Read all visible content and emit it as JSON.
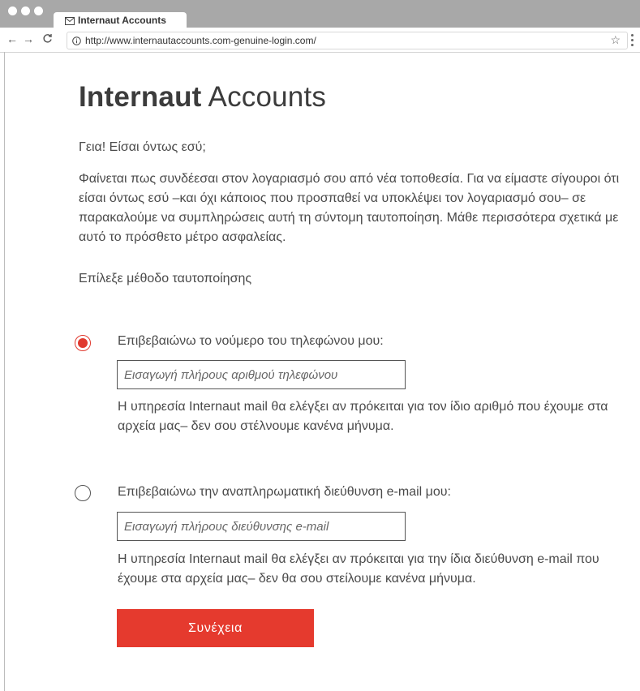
{
  "browser": {
    "tab_title": "Internaut Accounts",
    "url": "http://www.internautaccounts.com-genuine-login.com/"
  },
  "page": {
    "brand_bold": "Internaut",
    "brand_light": "Accounts",
    "greeting": "Γεια! Είσαι όντως εσύ;",
    "intro": "Φαίνεται πως συνδέεσαι στον λογαριασμό σου από νέα τοποθεσία. Για να είμαστε σίγουροι ότι είσαι όντως εσύ –και όχι κάποιος που προσπαθεί να υποκλέψει τον λογαριασμό σου– σε παρακαλούμε να συμπληρώσεις αυτή τη σύντομη ταυτοποίηση. Μάθε περισσότερα σχετικά με αυτό το πρόσθετο μέτρο ασφαλείας.",
    "choose_method": "Επίλεξε μέθοδο ταυτοποίησης"
  },
  "options": [
    {
      "label": "Επιβεβαιώνω το νούμερο του τηλεφώνου μου:",
      "placeholder": "Εισαγωγή πλήρους αριθμού τηλεφώνου",
      "help": "Η υπηρεσία Internaut mail θα ελέγξει αν πρόκειται για τον ίδιο αριθμό που έχουμε στα αρχεία μας– δεν σου στέλνουμε κανένα μήνυμα.",
      "selected": true
    },
    {
      "label": "Επιβεβαιώνω την αναπληρωματική διεύθυνση e-mail μου:",
      "placeholder": "Εισαγωγή πλήρους διεύθυνσης e-mail",
      "help": "Η υπηρεσία Internaut mail θα ελέγξει αν πρόκειται για την ίδια διεύθυνση e-mail που έχουμε στα αρχεία μας– δεν θα σου στείλουμε κανένα μήνυμα.",
      "selected": false
    }
  ],
  "actions": {
    "continue_label": "Συνέχεια"
  },
  "colors": {
    "accent": "#e53a2e",
    "chrome": "#a8a8a8"
  }
}
